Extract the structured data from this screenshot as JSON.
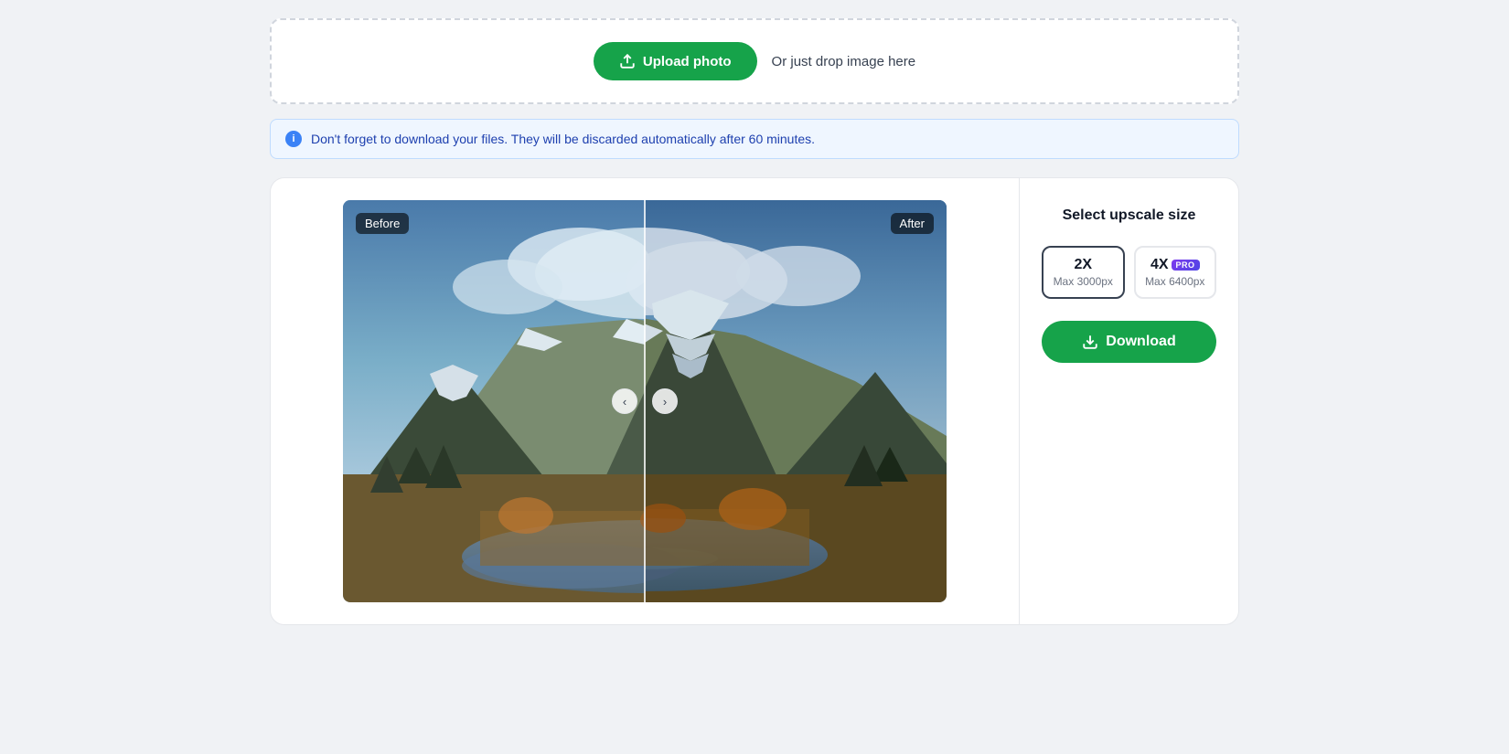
{
  "upload": {
    "button_label": "Upload photo",
    "drop_label": "Or just drop image here"
  },
  "info_banner": {
    "message": "Don't forget to download your files. They will be discarded automatically after 60 minutes."
  },
  "comparison": {
    "before_label": "Before",
    "after_label": "After",
    "arrow_left": "‹",
    "arrow_right": "›"
  },
  "sidebar": {
    "select_label": "Select upscale size",
    "option_2x_label": "2X",
    "option_2x_max": "Max 3000px",
    "option_4x_label": "4X",
    "option_4x_max": "Max 6400px",
    "pro_badge": "PRO",
    "download_label": "Download"
  }
}
